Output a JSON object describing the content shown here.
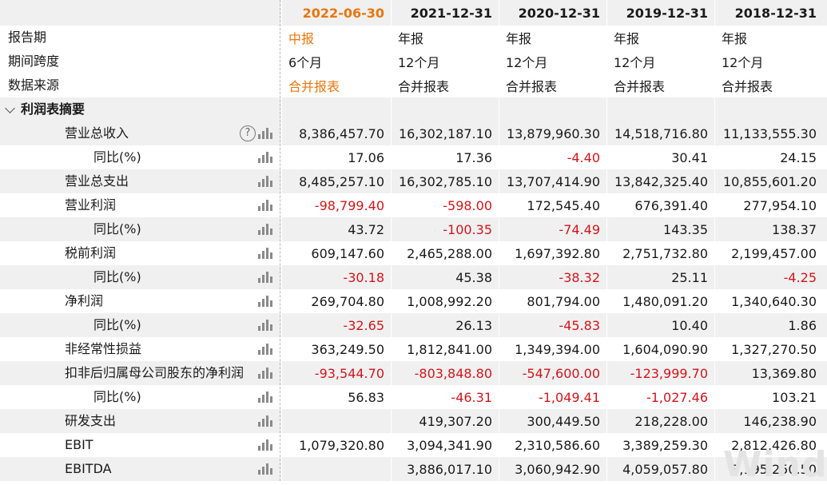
{
  "header": {
    "periods": [
      "2022-06-30",
      "2021-12-31",
      "2020-12-31",
      "2019-12-31",
      "2018-12-31"
    ]
  },
  "meta_rows": [
    {
      "label": "报告期",
      "values": [
        "中报",
        "年报",
        "年报",
        "年报",
        "年报"
      ]
    },
    {
      "label": "期间跨度",
      "values": [
        "6个月",
        "12个月",
        "12个月",
        "12个月",
        "12个月"
      ]
    },
    {
      "label": "数据来源",
      "values": [
        "合并报表",
        "合并报表",
        "合并报表",
        "合并报表",
        "合并报表"
      ]
    }
  ],
  "section": {
    "label": "利润表摘要"
  },
  "rows": [
    {
      "label": "营业总收入",
      "level": 1,
      "help": true,
      "values": [
        "8,386,457.70",
        "16,302,187.10",
        "13,879,960.30",
        "14,518,716.80",
        "11,133,555.30"
      ]
    },
    {
      "label": "同比(%)",
      "level": 2,
      "values": [
        "17.06",
        "17.36",
        "-4.40",
        "30.41",
        "24.15"
      ]
    },
    {
      "label": "营业总支出",
      "level": 1,
      "values": [
        "8,485,257.10",
        "16,302,785.10",
        "13,707,414.90",
        "13,842,325.40",
        "10,855,601.20"
      ]
    },
    {
      "label": "营业利润",
      "level": 1,
      "values": [
        "-98,799.40",
        "-598.00",
        "172,545.40",
        "676,391.40",
        "277,954.10"
      ]
    },
    {
      "label": "同比(%)",
      "level": 2,
      "values": [
        "43.72",
        "-100.35",
        "-74.49",
        "143.35",
        "138.37"
      ]
    },
    {
      "label": "税前利润",
      "level": 1,
      "values": [
        "609,147.60",
        "2,465,288.00",
        "1,697,392.80",
        "2,751,732.80",
        "2,199,457.00"
      ]
    },
    {
      "label": "同比(%)",
      "level": 2,
      "values": [
        "-30.18",
        "45.38",
        "-38.32",
        "25.11",
        "-4.25"
      ]
    },
    {
      "label": "净利润",
      "level": 1,
      "values": [
        "269,704.80",
        "1,008,992.20",
        "801,794.00",
        "1,480,091.20",
        "1,340,640.30"
      ]
    },
    {
      "label": "同比(%)",
      "level": 2,
      "values": [
        "-32.65",
        "26.13",
        "-45.83",
        "10.40",
        "1.86"
      ]
    },
    {
      "label": "非经常性损益",
      "level": 1,
      "values": [
        "363,249.50",
        "1,812,841.00",
        "1,349,394.00",
        "1,604,090.90",
        "1,327,270.50"
      ]
    },
    {
      "label": "扣非后归属母公司股东的净利润",
      "level": 1,
      "values": [
        "-93,544.70",
        "-803,848.80",
        "-547,600.00",
        "-123,999.70",
        "13,369.80"
      ]
    },
    {
      "label": "同比(%)",
      "level": 2,
      "values": [
        "56.83",
        "-46.31",
        "-1,049.41",
        "-1,027.46",
        "103.21"
      ]
    },
    {
      "label": "研发支出",
      "level": 1,
      "values": [
        "",
        "419,307.20",
        "300,449.50",
        "218,228.00",
        "146,238.90"
      ]
    },
    {
      "label": "EBIT",
      "level": 1,
      "values": [
        "1,079,320.80",
        "3,094,341.90",
        "2,310,586.60",
        "3,389,259.30",
        "2,812,426.80"
      ]
    },
    {
      "label": "EBITDA",
      "level": 1,
      "values": [
        "",
        "3,886,017.10",
        "3,060,942.90",
        "4,059,057.80",
        "3,195,250.50"
      ]
    }
  ],
  "watermark": "Wind",
  "colors": {
    "negative": "#d0161b",
    "current_period": "#e8760c",
    "row_shade": "#f0f0f0"
  },
  "icons": {
    "help": "question-circle-icon",
    "chart": "bar-chart-icon",
    "collapse": "chevron-down-icon"
  }
}
